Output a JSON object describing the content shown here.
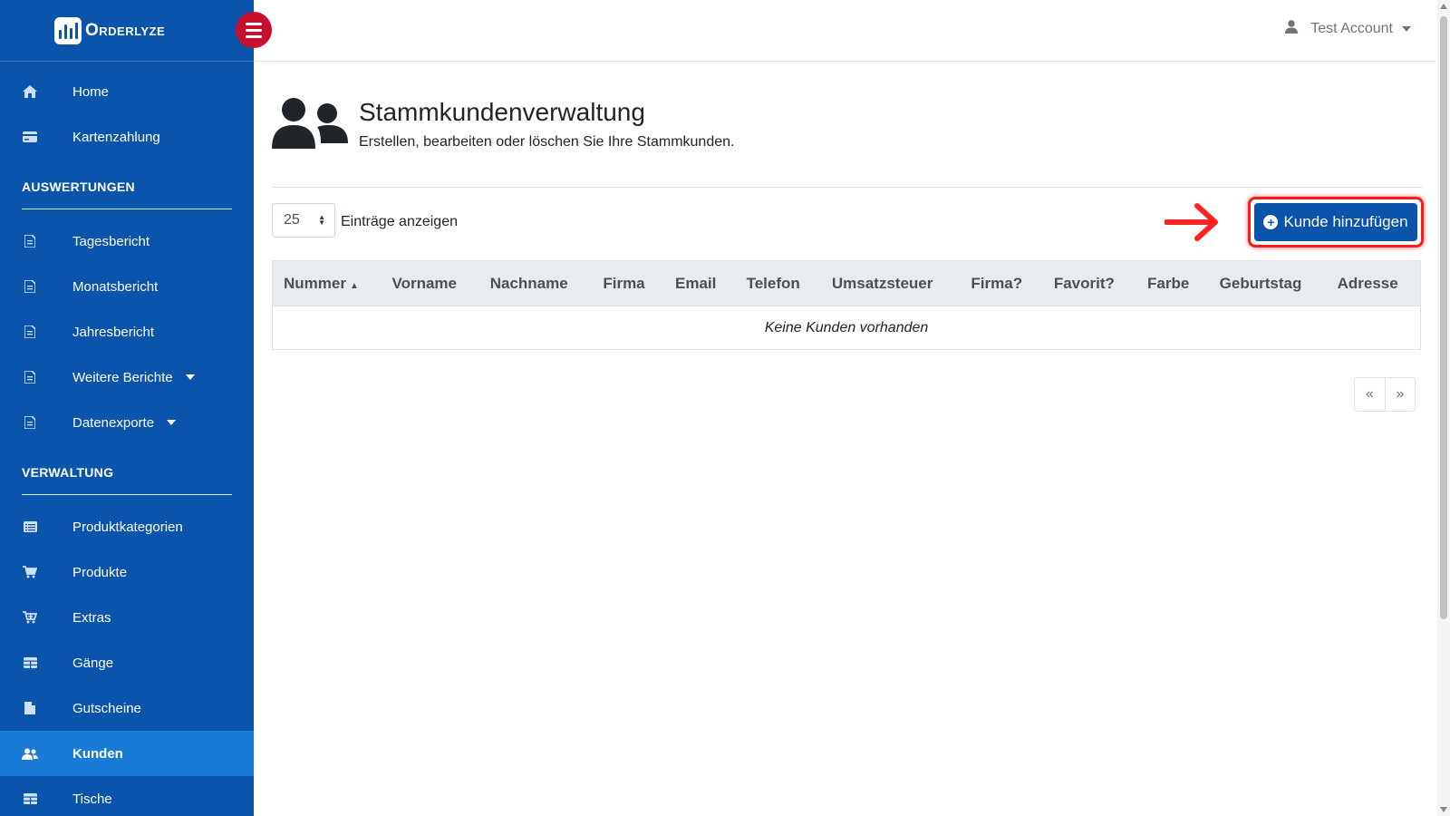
{
  "brand": {
    "name": "Orderlyze"
  },
  "sidebar": {
    "top_items": [
      {
        "label": "Home",
        "icon": "home-icon"
      },
      {
        "label": "Kartenzahlung",
        "icon": "credit-card-icon"
      }
    ],
    "sections": [
      {
        "title": "AUSWERTUNGEN",
        "items": [
          {
            "label": "Tagesbericht",
            "icon": "document-icon"
          },
          {
            "label": "Monatsbericht",
            "icon": "document-icon"
          },
          {
            "label": "Jahresbericht",
            "icon": "document-icon"
          },
          {
            "label": "Weitere Berichte",
            "icon": "document-icon",
            "dropdown": true
          },
          {
            "label": "Datenexporte",
            "icon": "document-icon",
            "dropdown": true
          }
        ]
      },
      {
        "title": "VERWALTUNG",
        "items": [
          {
            "label": "Produktkategorien",
            "icon": "list-icon"
          },
          {
            "label": "Produkte",
            "icon": "cart-icon"
          },
          {
            "label": "Extras",
            "icon": "cart-plus-icon"
          },
          {
            "label": "Gänge",
            "icon": "table-icon"
          },
          {
            "label": "Gutscheine",
            "icon": "file-icon"
          },
          {
            "label": "Kunden",
            "icon": "users-icon",
            "active": true
          },
          {
            "label": "Tische",
            "icon": "table-icon"
          }
        ]
      }
    ]
  },
  "header": {
    "account_label": "Test Account"
  },
  "page": {
    "title": "Stammkundenverwaltung",
    "subtitle": "Erstellen, bearbeiten oder löschen Sie Ihre Stammkunden."
  },
  "controls": {
    "page_size": "25",
    "entries_label": "Einträge anzeigen",
    "add_button_label": "Kunde hinzufügen"
  },
  "table": {
    "columns": [
      "Nummer",
      "Vorname",
      "Nachname",
      "Firma",
      "Email",
      "Telefon",
      "Umsatzsteuer",
      "Firma?",
      "Favorit?",
      "Farbe",
      "Geburtstag",
      "Adresse"
    ],
    "sorted_column": "Nummer",
    "empty_text": "Keine Kunden vorhanden"
  },
  "pagination": {
    "prev": "«",
    "next": "»"
  },
  "colors": {
    "sidebar": "#0a54ab",
    "active": "#1a7bd6",
    "toggle": "#c8102e",
    "highlight": "#ff1a1a"
  }
}
